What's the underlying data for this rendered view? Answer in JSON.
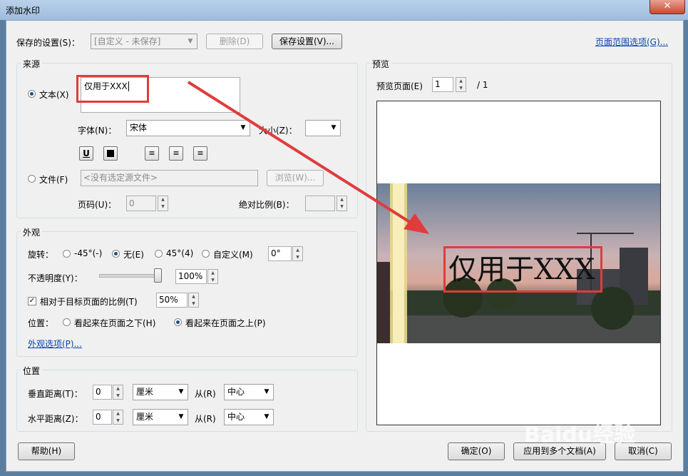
{
  "window": {
    "title": "添加水印",
    "close_glyph": "✕"
  },
  "saved_settings": {
    "label": "保存的设置(S)：",
    "value": "[自定义 - 未保存]",
    "delete_label": "删除(D)",
    "save_label": "保存设置(V)...",
    "page_range_link": "页面范围选项(G)..."
  },
  "source": {
    "group_title": "来源",
    "text_radio": "文本(X)",
    "text_value": "仅用于XXX",
    "font_label": "字体(N)：",
    "font_value": "宋体",
    "size_label": "大小(Z)：",
    "size_value": "",
    "file_radio": "文件(F)",
    "file_value": "<没有选定源文件>",
    "browse_label": "浏览(W)...",
    "page_label": "页码(U)：",
    "page_value": "0",
    "abs_scale_label": "绝对比例(B)："
  },
  "appearance": {
    "group_title": "外观",
    "rotation_label": "旋转：",
    "rot_options": [
      "-45°(-)",
      "无(E)",
      "45°(4)",
      "自定义(M)"
    ],
    "rot_custom_value": "0°",
    "opacity_label": "不透明度(Y)：",
    "opacity_value": "100%",
    "opacity_level": 1.0,
    "relative_scale_label": "相对于目标页面的比例(T)",
    "relative_scale_value": "50%",
    "position_label": "位置：",
    "pos_below": "看起来在页面之下(H)",
    "pos_above": "看起来在页面之上(P)",
    "options_link": "外观选项(P)..."
  },
  "position": {
    "group_title": "位置",
    "vertical_label": "垂直距离(T)：",
    "vertical_value": "0",
    "vertical_unit": "厘米",
    "vertical_from_label": "从(R)",
    "vertical_from_value": "中心",
    "horizontal_label": "水平距离(Z)：",
    "horizontal_value": "0",
    "horizontal_unit": "厘米",
    "horizontal_from_label": "从(R)",
    "horizontal_from_value": "中心"
  },
  "preview": {
    "group_title": "预览",
    "page_label": "预览页面(E)",
    "page_value": "1",
    "page_total": "/ 1",
    "watermark_text": "仅用于XXX"
  },
  "buttons": {
    "help": "帮助(H)",
    "ok": "确定(O)",
    "apply_multi": "应用到多个文档(A)",
    "cancel": "取消(C)"
  },
  "overlay_watermark": "Baidu经验",
  "colors": {
    "annotation_red": "#e03c3c",
    "link": "#0645ad",
    "title_bar": "#b9d1ea"
  }
}
